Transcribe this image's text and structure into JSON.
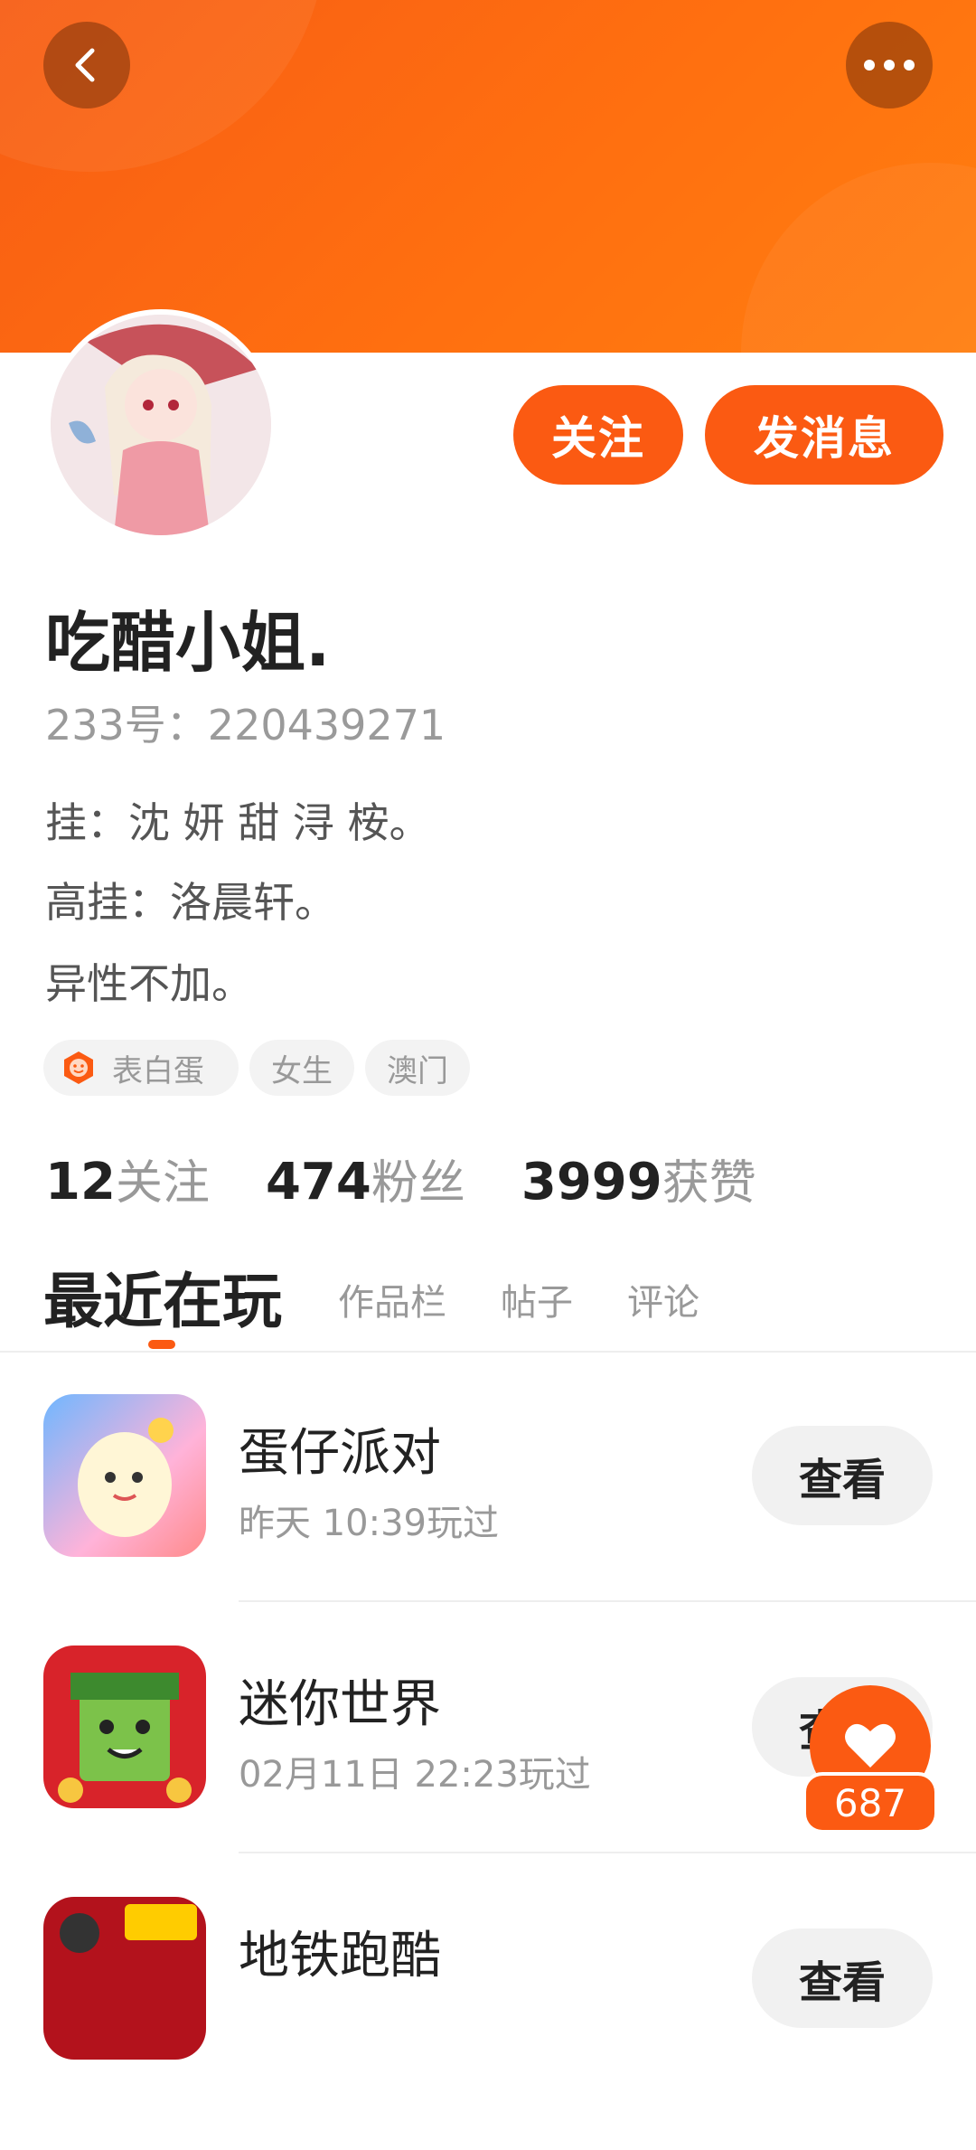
{
  "header": {
    "back_icon": "chevron-left-icon",
    "more_icon": "more-horizontal-icon"
  },
  "profile": {
    "nickname": "吃醋小姐.",
    "user_id": "233号：220439271",
    "bio_lines": [
      "挂：沈 妍 甜 浔 桉。",
      "高挂：洛晨轩。",
      "异性不加。"
    ],
    "follow_label": "关注",
    "message_label": "发消息",
    "tags": [
      {
        "label": "表白蛋",
        "icon": "egg-face-icon"
      },
      {
        "label": "女生"
      },
      {
        "label": "澳门"
      }
    ]
  },
  "stats": [
    {
      "value": "12",
      "label": "关注"
    },
    {
      "value": "474",
      "label": "粉丝"
    },
    {
      "value": "3999",
      "label": "获赞"
    }
  ],
  "tabs": [
    {
      "label": "最近在玩",
      "active": true
    },
    {
      "label": "作品栏"
    },
    {
      "label": "帖子"
    },
    {
      "label": "评论"
    }
  ],
  "games": [
    {
      "name": "蛋仔派对",
      "played": "昨天 10:39玩过",
      "action": "查看"
    },
    {
      "name": "迷你世界",
      "played": "02月11日 22:23玩过",
      "action": "查看"
    },
    {
      "name": "地铁跑酷",
      "played": "",
      "action": "查看"
    }
  ],
  "like": {
    "count": "687",
    "icon": "heart-icon"
  },
  "colors": {
    "accent": "#fb5a12",
    "header_gradient_start": "#f75d14",
    "header_gradient_end": "#ff7e0f"
  }
}
